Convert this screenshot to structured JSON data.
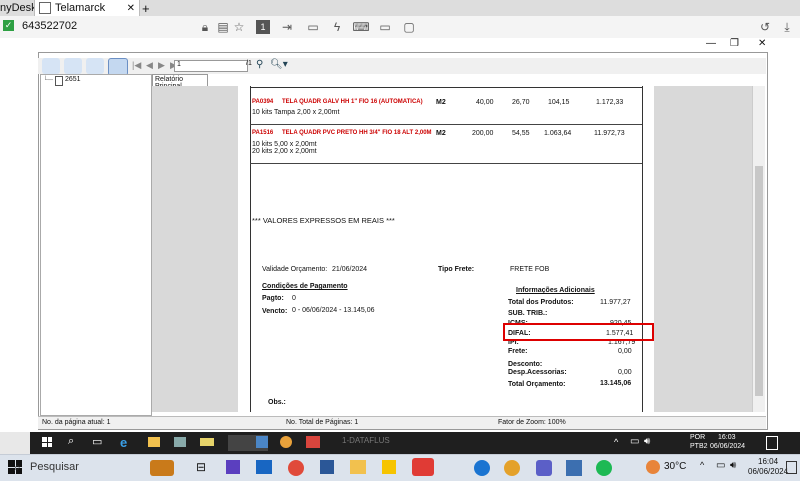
{
  "anydesk": {
    "app": "nyDesk",
    "tab_label": "Telamarck",
    "address": "643522702"
  },
  "viewer": {
    "page_input": "1",
    "page_total": "/1",
    "tree_item": "2651",
    "report_tab": "Relatório Principal",
    "status_left": "No. da página atual: 1",
    "status_mid": "No. Total de Páginas: 1",
    "status_right": "Fator de Zoom: 100%"
  },
  "report": {
    "items": [
      {
        "code": "PA0394",
        "desc": "TELA QUADR GALV HH 1\" FIO 16 (AUTOMATICA)",
        "unit": "M2",
        "qty": "40,00",
        "price": "26,70",
        "val": "104,15",
        "total": "1.172,33",
        "notes": [
          "10 kits Tampa 2,00 x 2,00mt"
        ]
      },
      {
        "code": "PA1516",
        "desc": "TELA QUADR PVC PRETO HH 3/4\" FIO 18 ALT 2,00M",
        "unit": "M2",
        "qty": "200,00",
        "price": "54,55",
        "val": "1.063,64",
        "total": "11.972,73",
        "notes": [
          "10 kits 5,00 x 2,00mt",
          "20 kits 2,00 x 2,00mt"
        ]
      }
    ],
    "valores": "*** VALORES EXPRESSOS EM REAIS ***",
    "validade_label": "Validade Orçamento:",
    "validade_value": "21/06/2024",
    "tipo_frete_label": "Tipo Frete:",
    "tipo_frete_value": "FRETE FOB",
    "cond_title": "Condições de Pagamento",
    "pagto_label": "Pagto:",
    "pagto_value": "0",
    "vencto_label": "Vencto:",
    "vencto_value": "0 - 06/06/2024 - 13.145,06",
    "info_title": "Informações Adicionais",
    "totals": [
      {
        "label": "Total dos Produtos:",
        "value": "11.977,27"
      },
      {
        "label": "SUB. TRIB.:",
        "value": ""
      },
      {
        "label": "ICMS:",
        "value": "920,45"
      },
      {
        "label": "DIFAL:",
        "value": "1.577,41"
      },
      {
        "label": "IPI:",
        "value": "1.167,79"
      },
      {
        "label": "Frete:",
        "value": "0,00"
      },
      {
        "label": "Desconto:",
        "value": ""
      },
      {
        "label": "Desp.Acessorias:",
        "value": "0,00"
      },
      {
        "label": "Total Orçamento:",
        "value": "13.145,06"
      }
    ],
    "obs_label": "Obs.:"
  },
  "remote_taskbar": {
    "label": "1-DATAFLUS",
    "lang": "POR",
    "lang2": "PTB2",
    "time": "16:03",
    "date": "06/06/2024"
  },
  "local_taskbar": {
    "search": "Pesquisar",
    "weather": "30°C",
    "time": "16:04",
    "date": "06/06/2024"
  },
  "colors": {
    "accent_red": "#d00000",
    "taskbar_dark": "#1f1f1f"
  }
}
